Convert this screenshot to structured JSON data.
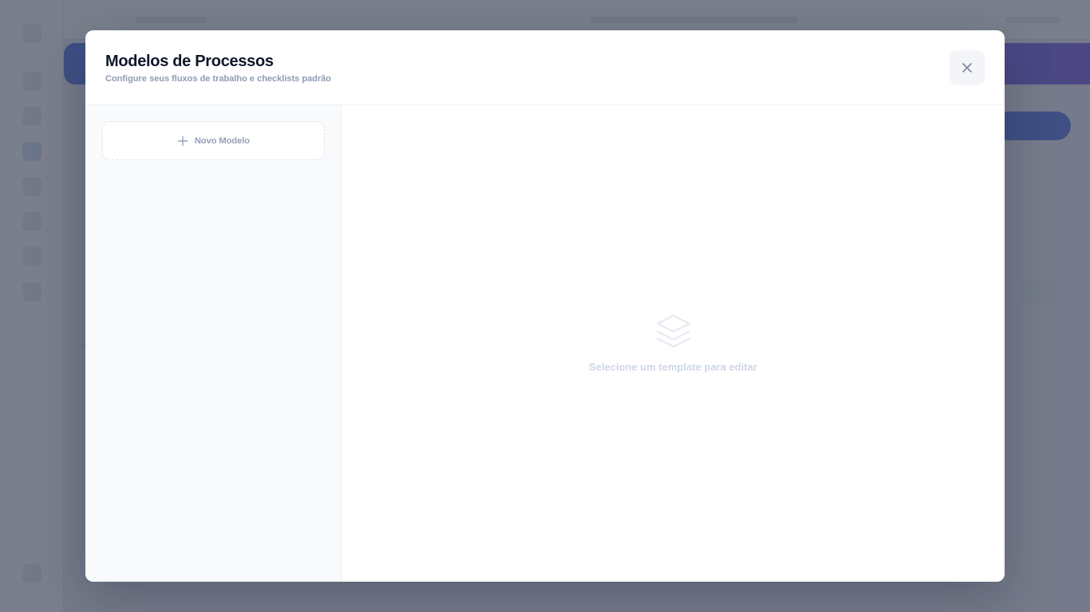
{
  "modal": {
    "title": "Modelos de Processos",
    "subtitle": "Configure seus fluxos de trabalho e checklists padrão",
    "close_icon": "close-icon"
  },
  "sidebar": {
    "new_template_label": "Novo Modelo",
    "new_template_icon": "plus-icon"
  },
  "editor": {
    "empty_icon": "layers-icon",
    "empty_message": "Selecione um template para editar"
  },
  "colors": {
    "overlay": "#474d5f",
    "title": "#0f172a",
    "muted": "#8f9bb3",
    "accent_background": "#2f55e0"
  }
}
